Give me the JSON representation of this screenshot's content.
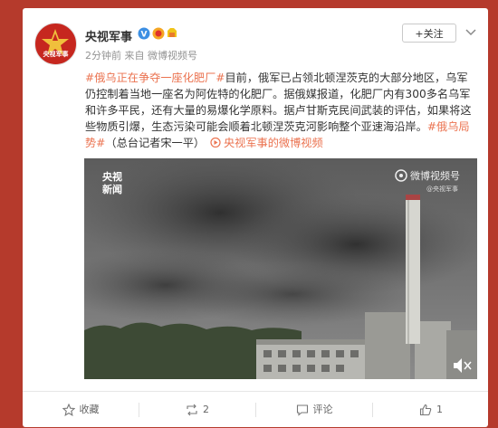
{
  "post": {
    "author": {
      "name": "央视军事",
      "avatar_text": "央视军事"
    },
    "meta": "2分钟前 来自 微博视频号",
    "follow_label": "+关注",
    "text": {
      "tag1": "#俄乌正在争夺一座化肥厂#",
      "body1": "目前，俄军已占领北顿涅茨克的大部分地区，乌军仍控制着当地一座名为阿佐特的化肥厂。据俄媒报道，化肥厂内有300多名乌军和许多平民，还有大量的易爆化学原料。据卢甘斯克民间武装的评估，如果将这些物质引爆，生态污染可能会顺着北顿涅茨克河影响整个亚速海沿岸。",
      "tag2": "#俄乌局势#",
      "body2": "（总台记者宋一平）",
      "video_link": "央视军事的微博视频"
    },
    "video": {
      "logo_line1": "央视",
      "logo_line2": "新闻",
      "watermark_title": "微博视频号",
      "watermark_sub": "@央视军事"
    },
    "actions": {
      "favorite": "收藏",
      "repost": "2",
      "comment": "评论",
      "like": "1"
    }
  },
  "colors": {
    "page_bg": "#b53a2c",
    "link": "#eb7350",
    "brand_red": "#c6271f"
  }
}
